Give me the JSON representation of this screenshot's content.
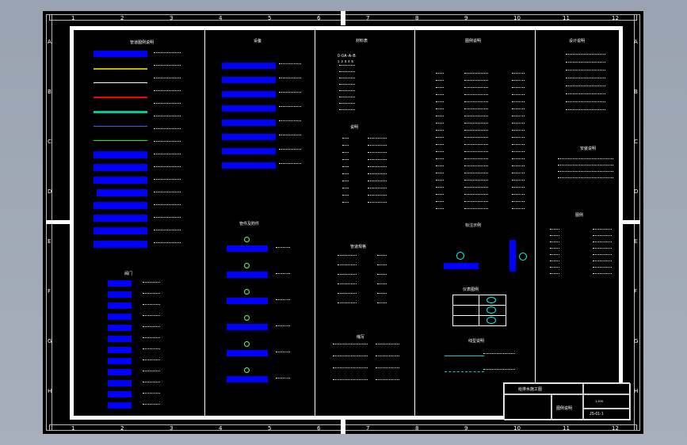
{
  "drawing": {
    "col_numbers": [
      "1",
      "2",
      "3",
      "4",
      "5",
      "6",
      "7",
      "8",
      "9",
      "10",
      "11",
      "12"
    ],
    "row_letters": [
      "A",
      "B",
      "C",
      "D",
      "E",
      "F",
      "G",
      "H"
    ],
    "sections": {
      "pipe_legend_title": "管道图例说明",
      "valves_title": "阀门",
      "equipment_title": "设备",
      "fittings_title": "管件及附件",
      "materials_title": "材料表",
      "notes_title": "说明",
      "legend_title": "图例",
      "install_title": "安装说明",
      "table_title": "图例说明",
      "abbrev_title": "缩写",
      "spec_title": "管道规格",
      "mark_title": "标注示例",
      "table2_title": "仪表图例",
      "line_title": "线型说明",
      "right_title": "设计说明"
    },
    "code_line": "0-0A-A-B",
    "code_digits": "1 2 3 4 5",
    "title_block": {
      "project": "给排水施工图",
      "drawing_name": "图例说明",
      "drawing_no": "JS-01-1",
      "scale": "1:100"
    }
  }
}
